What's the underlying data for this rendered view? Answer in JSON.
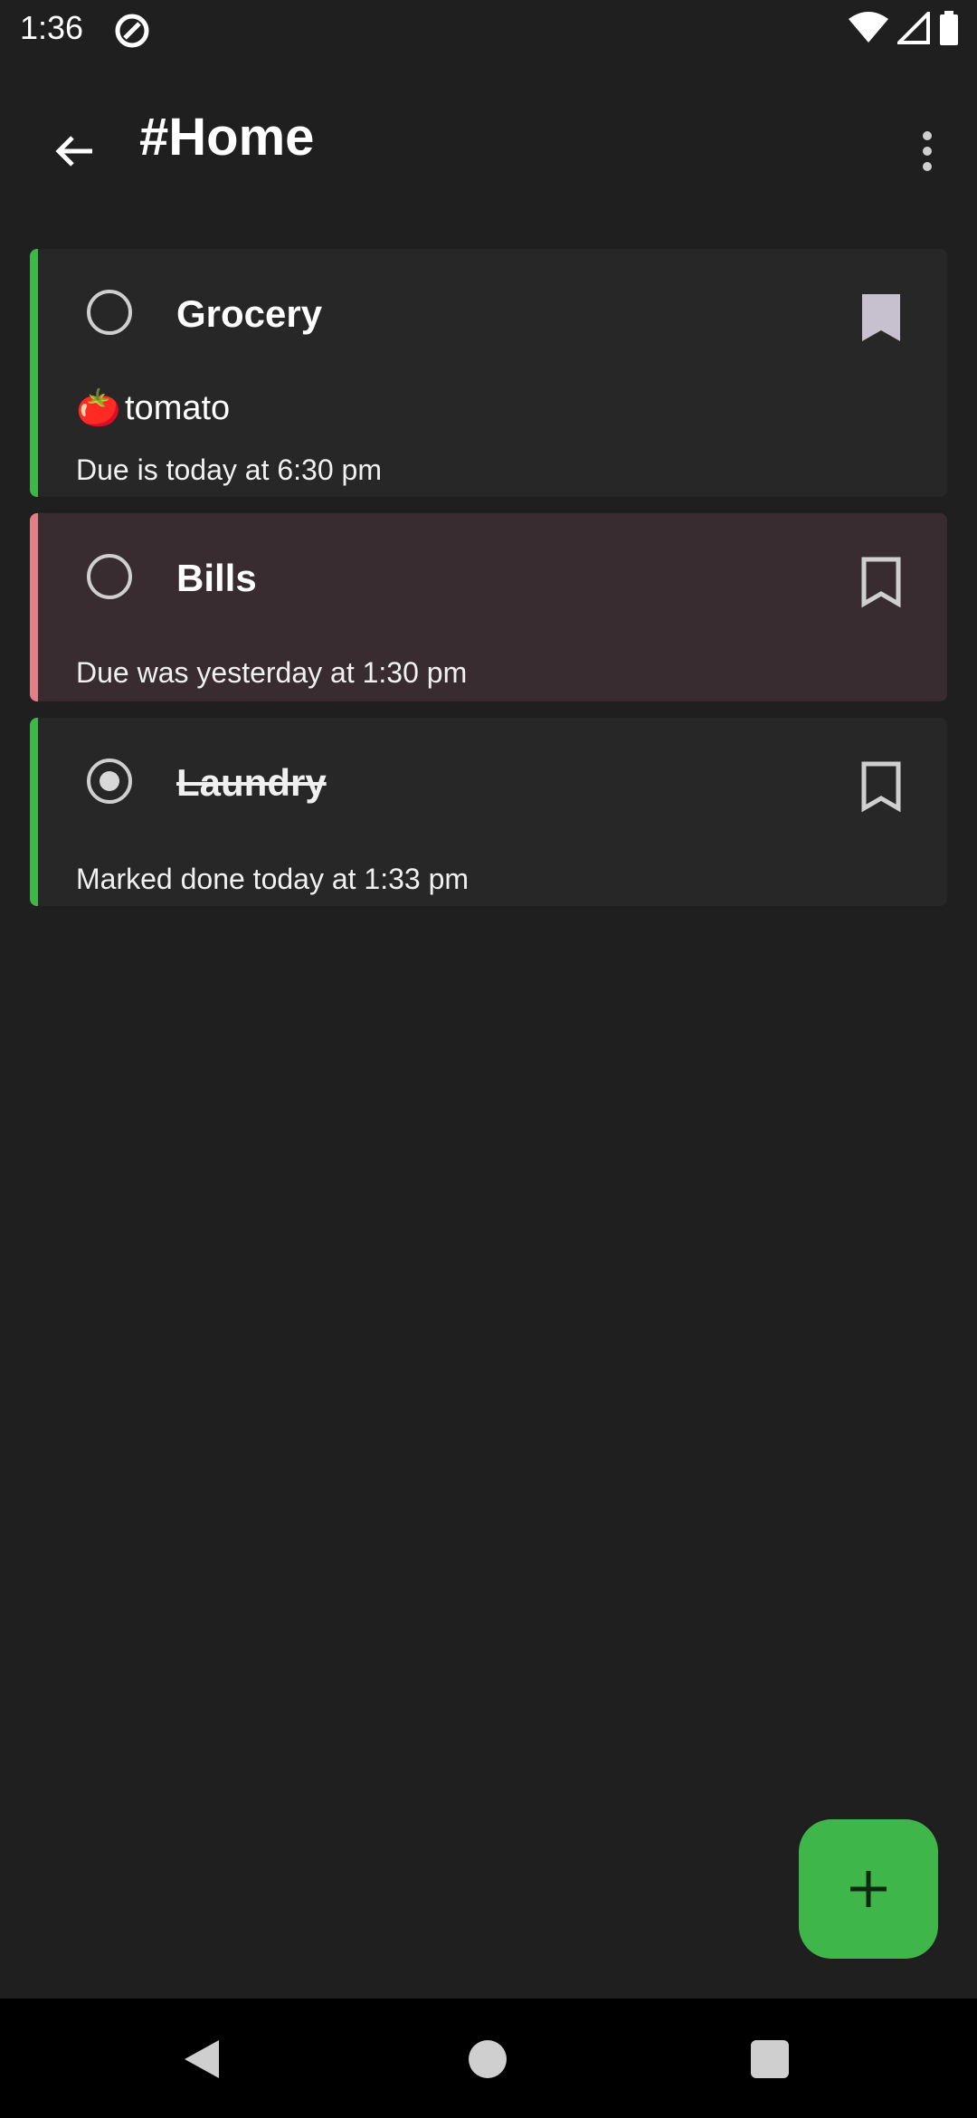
{
  "status_bar": {
    "time": "1:36",
    "icons": [
      "app-notification-icon",
      "wifi-icon",
      "signal-icon",
      "battery-icon"
    ]
  },
  "header": {
    "title": "#Home",
    "back_icon": "arrow-back-icon",
    "menu_icon": "more-vert-icon"
  },
  "tasks": [
    {
      "title": "Grocery",
      "checked": false,
      "bookmarked": true,
      "item_emoji": "🍅",
      "item_text": "tomato",
      "subtitle": "Due is today at 6:30 pm",
      "accent": "#3fb64a"
    },
    {
      "title": "Bills",
      "checked": false,
      "bookmarked": false,
      "subtitle": "Due was yesterday at 1:30 pm",
      "accent": "#e07f86"
    },
    {
      "title": "Laundry",
      "checked": true,
      "bookmarked": false,
      "subtitle": "Marked done today at 1:33 pm",
      "accent": "#3fb64a"
    }
  ],
  "fab": {
    "icon": "plus-icon"
  },
  "colors": {
    "background": "#1f1f1f",
    "card": "#272727",
    "overdue_card": "#382c31",
    "fab": "#3fb64a"
  }
}
